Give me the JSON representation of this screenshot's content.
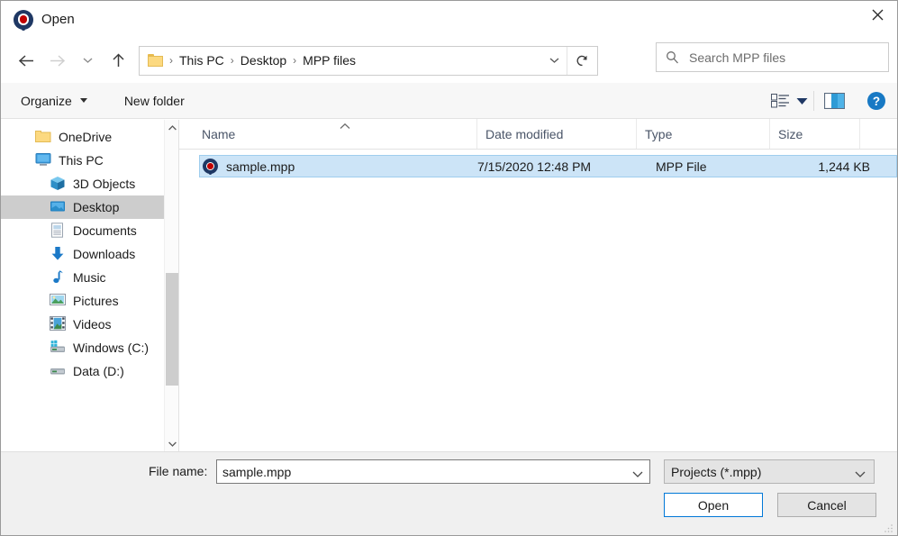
{
  "window": {
    "title": "Open",
    "icon": "mpp-project-icon",
    "close_label": "✕"
  },
  "nav": {
    "back_icon": "arrow-left-icon",
    "forward_icon": "arrow-right-icon",
    "recent_icon": "chevron-down-icon",
    "up_icon": "arrow-up-icon",
    "refresh_icon": "refresh-icon",
    "breadcrumb_dropdown_icon": "chevron-down-icon"
  },
  "breadcrumb": {
    "folder_icon": "folder-icon",
    "separator": "›",
    "items": [
      "This PC",
      "Desktop",
      "MPP files"
    ]
  },
  "search": {
    "icon": "search-icon",
    "placeholder": "Search MPP files",
    "value": ""
  },
  "toolbar": {
    "organize_label": "Organize",
    "new_folder_label": "New folder",
    "view_icon": "list-view-icon",
    "view_caret_icon": "chevron-down-icon",
    "preview_pane_icon": "preview-pane-icon",
    "help_icon": "help-icon"
  },
  "sidebar": {
    "items": [
      {
        "label": "OneDrive",
        "icon": "onedrive-folder-icon",
        "indent": 0,
        "selected": false
      },
      {
        "label": "This PC",
        "icon": "this-pc-icon",
        "indent": 0,
        "selected": false
      },
      {
        "label": "3D Objects",
        "icon": "3d-objects-icon",
        "indent": 2,
        "selected": false
      },
      {
        "label": "Desktop",
        "icon": "desktop-icon",
        "indent": 2,
        "selected": true
      },
      {
        "label": "Documents",
        "icon": "documents-icon",
        "indent": 2,
        "selected": false
      },
      {
        "label": "Downloads",
        "icon": "downloads-icon",
        "indent": 2,
        "selected": false
      },
      {
        "label": "Music",
        "icon": "music-icon",
        "indent": 2,
        "selected": false
      },
      {
        "label": "Pictures",
        "icon": "pictures-icon",
        "indent": 2,
        "selected": false
      },
      {
        "label": "Videos",
        "icon": "videos-icon",
        "indent": 2,
        "selected": false
      },
      {
        "label": "Windows (C:)",
        "icon": "windows-drive-icon",
        "indent": 2,
        "selected": false
      },
      {
        "label": "Data (D:)",
        "icon": "drive-icon",
        "indent": 2,
        "selected": false
      }
    ],
    "scroll_up_icon": "chevron-up-icon",
    "scroll_down_icon": "chevron-down-icon"
  },
  "filelist": {
    "columns": [
      "Name",
      "Date modified",
      "Type",
      "Size"
    ],
    "sort_column": "Name",
    "sort_direction": "ascending",
    "sort_icon": "chevron-up-icon",
    "rows": [
      {
        "name": "sample.mpp",
        "date_modified": "7/15/2020 12:48 PM",
        "type": "MPP File",
        "size": "1,244 KB",
        "icon": "mpp-project-icon",
        "selected": true
      }
    ]
  },
  "footer": {
    "file_name_label": "File name:",
    "file_name_value": "sample.mpp",
    "file_name_chevron_icon": "chevron-down-icon",
    "filter_value": "Projects (*.mpp)",
    "filter_chevron_icon": "chevron-down-icon",
    "open_label": "Open",
    "cancel_label": "Cancel",
    "resize_grip_icon": "resize-grip-icon"
  },
  "colors": {
    "accent": "#0078d7",
    "selection_fill": "#cce4f7",
    "selection_border": "#9fcdee",
    "sidebar_selection": "#cdcdcd",
    "chrome": "#f0f0f0",
    "toolbar": "#f7f7f7",
    "mpp_blue": "#1f3864",
    "mpp_red": "#c00000"
  }
}
